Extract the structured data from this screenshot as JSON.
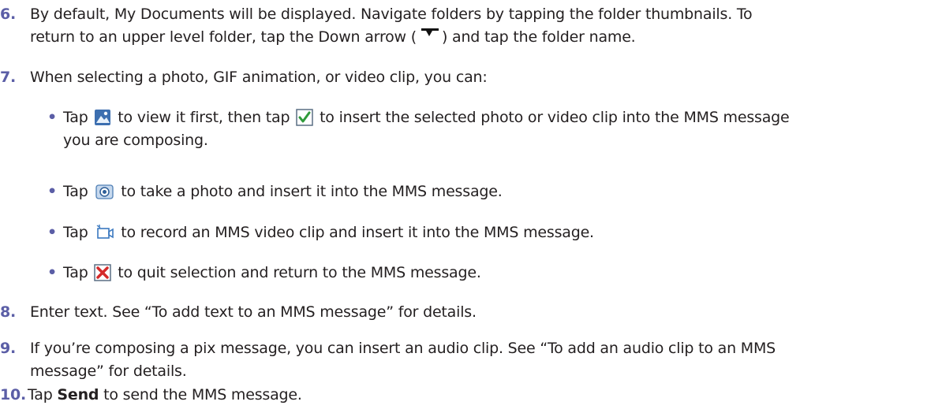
{
  "step6": {
    "num": "6.",
    "line1": "By default, My Documents will be displayed. Navigate folders by tapping the folder thumbnails. To",
    "line2a": "return to an upper level folder, tap the Down arrow (",
    "line2b": ") and tap the folder name."
  },
  "step7": {
    "num": "7.",
    "text": "When selecting a photo, GIF animation, or video clip, you can:"
  },
  "bullets": {
    "view": {
      "a": "Tap",
      "b": "to view it first, then tap",
      "c": "to insert the selected photo or video clip into the MMS message",
      "d": "you are composing."
    },
    "camera": {
      "a": "Tap",
      "b": "to take a photo and insert it into the MMS message."
    },
    "video": {
      "a": "Tap",
      "b": "to record an MMS video clip and insert it into the MMS message."
    },
    "quit": {
      "a": "Tap",
      "b": "to quit selection and return to the MMS message."
    }
  },
  "step8": {
    "num": "8.",
    "text": "Enter text. See “To add text to an MMS message” for details."
  },
  "step9": {
    "num": "9.",
    "line1": "If you’re composing a pix message, you can insert an audio clip. See “To add an audio clip to an MMS",
    "line2": "message” for details."
  },
  "step10": {
    "num": "10.",
    "a": "Tap",
    "send": "Send",
    "b": "to send the MMS message."
  },
  "icons": {
    "down_arrow": "down-arrow-icon",
    "view": "view-photo-icon",
    "insert": "checkmark-icon",
    "camera": "camera-icon",
    "video": "video-camera-icon",
    "quit": "close-icon"
  },
  "colors": {
    "number": "#5b5ea6",
    "text": "#231f20"
  }
}
